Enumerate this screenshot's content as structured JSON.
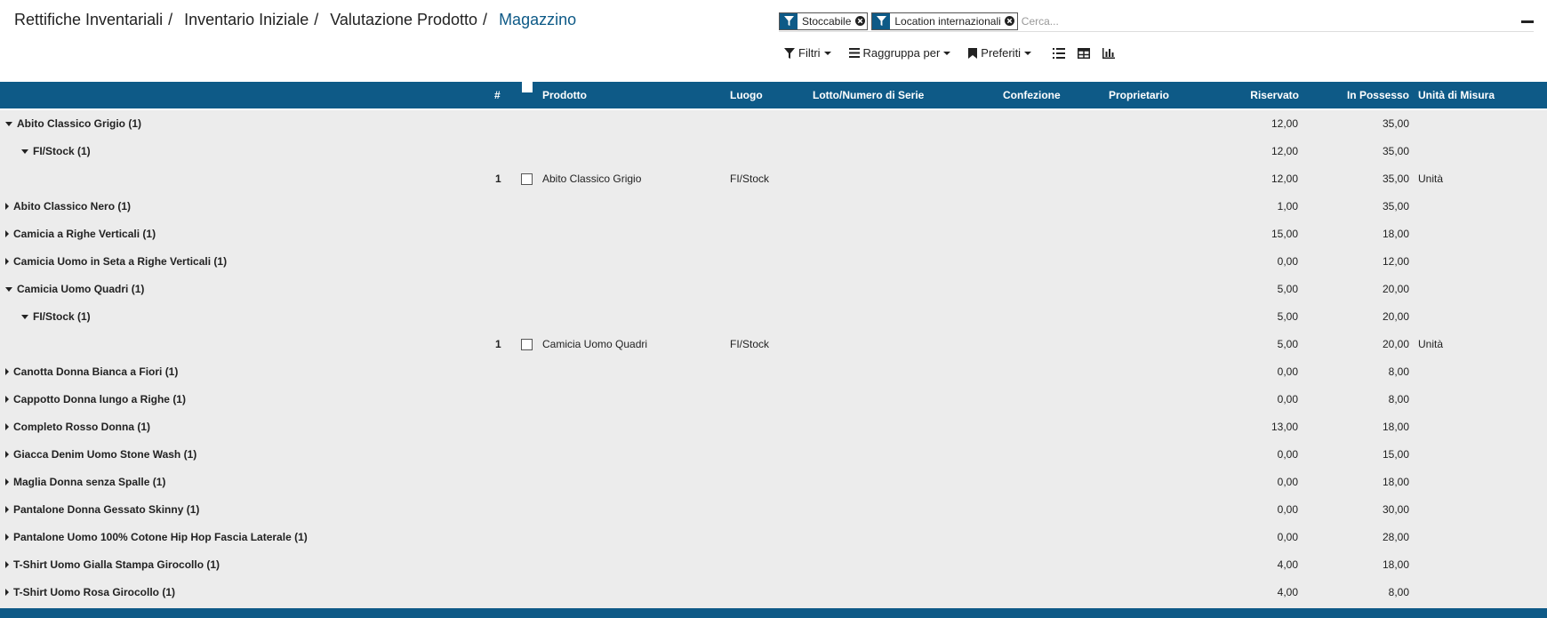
{
  "breadcrumb": [
    "Rettifiche Inventariali",
    "Inventario Iniziale",
    "Valutazione Prodotto",
    "Magazzino"
  ],
  "search": {
    "facets": [
      "Stoccabile",
      "Location internazionali"
    ],
    "placeholder": "Cerca..."
  },
  "toolbar": {
    "filters": "Filtri",
    "groupby": "Raggruppa per",
    "favorites": "Preferiti"
  },
  "columns": {
    "num": "#",
    "product": "Prodotto",
    "location": "Luogo",
    "lot": "Lotto/Numero di Serie",
    "package": "Confezione",
    "owner": "Proprietario",
    "reserved": "Riservato",
    "onhand": "In Possesso",
    "uom": "Unità di Misura"
  },
  "rows": [
    {
      "type": "group",
      "level": 0,
      "open": true,
      "label": "Abito Classico Grigio (1)",
      "reserved": "12,00",
      "onhand": "35,00"
    },
    {
      "type": "group",
      "level": 1,
      "open": true,
      "label": "FI/Stock (1)",
      "reserved": "12,00",
      "onhand": "35,00"
    },
    {
      "type": "record",
      "num": "1",
      "product": "Abito Classico Grigio",
      "location": "FI/Stock",
      "reserved": "12,00",
      "onhand": "35,00",
      "uom": "Unità"
    },
    {
      "type": "group",
      "level": 0,
      "open": false,
      "label": "Abito Classico Nero (1)",
      "reserved": "1,00",
      "onhand": "35,00"
    },
    {
      "type": "group",
      "level": 0,
      "open": false,
      "label": "Camicia a Righe Verticali (1)",
      "reserved": "15,00",
      "onhand": "18,00"
    },
    {
      "type": "group",
      "level": 0,
      "open": false,
      "label": "Camicia Uomo in Seta a Righe Verticali (1)",
      "reserved": "0,00",
      "onhand": "12,00"
    },
    {
      "type": "group",
      "level": 0,
      "open": true,
      "label": "Camicia Uomo Quadri (1)",
      "reserved": "5,00",
      "onhand": "20,00"
    },
    {
      "type": "group",
      "level": 1,
      "open": true,
      "label": "FI/Stock (1)",
      "reserved": "5,00",
      "onhand": "20,00"
    },
    {
      "type": "record",
      "num": "1",
      "product": "Camicia Uomo Quadri",
      "location": "FI/Stock",
      "reserved": "5,00",
      "onhand": "20,00",
      "uom": "Unità"
    },
    {
      "type": "group",
      "level": 0,
      "open": false,
      "label": "Canotta Donna Bianca a Fiori (1)",
      "reserved": "0,00",
      "onhand": "8,00"
    },
    {
      "type": "group",
      "level": 0,
      "open": false,
      "label": "Cappotto Donna lungo a Righe (1)",
      "reserved": "0,00",
      "onhand": "8,00"
    },
    {
      "type": "group",
      "level": 0,
      "open": false,
      "label": "Completo Rosso Donna (1)",
      "reserved": "13,00",
      "onhand": "18,00"
    },
    {
      "type": "group",
      "level": 0,
      "open": false,
      "label": "Giacca Denim Uomo Stone Wash (1)",
      "reserved": "0,00",
      "onhand": "15,00"
    },
    {
      "type": "group",
      "level": 0,
      "open": false,
      "label": "Maglia Donna senza Spalle (1)",
      "reserved": "0,00",
      "onhand": "18,00"
    },
    {
      "type": "group",
      "level": 0,
      "open": false,
      "label": "Pantalone Donna Gessato Skinny (1)",
      "reserved": "0,00",
      "onhand": "30,00"
    },
    {
      "type": "group",
      "level": 0,
      "open": false,
      "label": "Pantalone Uomo 100% Cotone Hip Hop Fascia Laterale (1)",
      "reserved": "0,00",
      "onhand": "28,00"
    },
    {
      "type": "group",
      "level": 0,
      "open": false,
      "label": "T-Shirt Uomo Gialla Stampa Girocollo (1)",
      "reserved": "4,00",
      "onhand": "18,00"
    },
    {
      "type": "group",
      "level": 0,
      "open": false,
      "label": "T-Shirt Uomo Rosa Girocollo (1)",
      "reserved": "4,00",
      "onhand": "8,00"
    }
  ],
  "colors": {
    "accent": "#0e5a87",
    "body_bg": "#ececec"
  }
}
